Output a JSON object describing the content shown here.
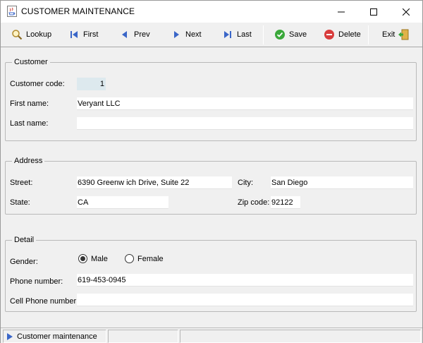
{
  "window": {
    "title": "CUSTOMER MAINTENANCE",
    "icon": "java-cup-icon"
  },
  "toolbar": {
    "lookup": "Lookup",
    "first": "First",
    "prev": "Prev",
    "next": "Next",
    "last": "Last",
    "save": "Save",
    "delete": "Delete",
    "exit": "Exit",
    "colors": {
      "nav_blue": "#3a66c8",
      "save_green": "#3aa83a",
      "delete_red": "#d83c3c"
    }
  },
  "customer": {
    "legend": "Customer",
    "code_label": "Customer code:",
    "code_value": "1",
    "first_name_label": "First name:",
    "first_name_value": "Veryant LLC",
    "last_name_label": "Last name:",
    "last_name_value": ""
  },
  "address": {
    "legend": "Address",
    "street_label": "Street:",
    "street_value": "6390 Greenw ich Drive, Suite 22",
    "city_label": "City:",
    "city_value": "San Diego",
    "state_label": "State:",
    "state_value": "CA",
    "zip_label": "Zip code:",
    "zip_value": "92122"
  },
  "detail": {
    "legend": "Detail",
    "gender_label": "Gender:",
    "gender_options": [
      "Male",
      "Female"
    ],
    "gender_selected": "Male",
    "phone_label": "Phone number:",
    "phone_value": "619-453-0945",
    "cell_label": "Cell Phone number:",
    "cell_value": ""
  },
  "status": {
    "text": "Customer maintenance"
  }
}
